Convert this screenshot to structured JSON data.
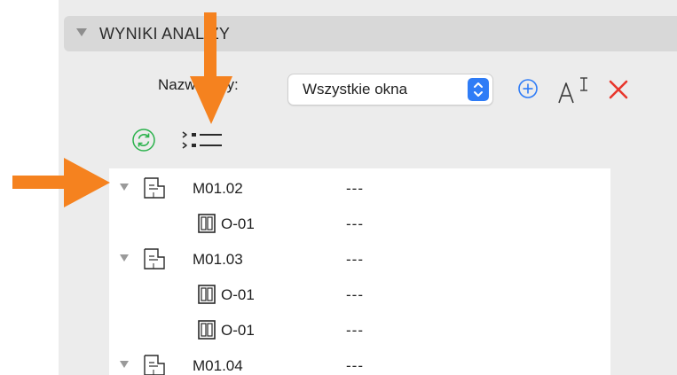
{
  "section": {
    "title": "WYNIKI ANALIZY"
  },
  "filter": {
    "label": "Nazwa listy:",
    "selected": "Wszystkie okna"
  },
  "tree": {
    "rows": [
      {
        "kind": "zone",
        "name": "M01.02",
        "value": "---"
      },
      {
        "kind": "window",
        "name": "O-01",
        "value": "---"
      },
      {
        "kind": "zone",
        "name": "M01.03",
        "value": "---"
      },
      {
        "kind": "window",
        "name": "O-01",
        "value": "---"
      },
      {
        "kind": "window",
        "name": "O-01",
        "value": "---"
      },
      {
        "kind": "zone",
        "name": "M01.04",
        "value": "---"
      }
    ]
  },
  "colors": {
    "accent": "#2f7cf6",
    "delete": "#e8352b",
    "refresh": "#2bb24c",
    "annotation_arrow": "#f5821f"
  },
  "icons": {
    "add": "plus-circle-icon",
    "rename": "text-rename-icon",
    "delete": "x-icon",
    "refresh": "refresh-icon",
    "list": "list-expand-icon",
    "zone": "zone-icon",
    "window": "window-icon"
  }
}
